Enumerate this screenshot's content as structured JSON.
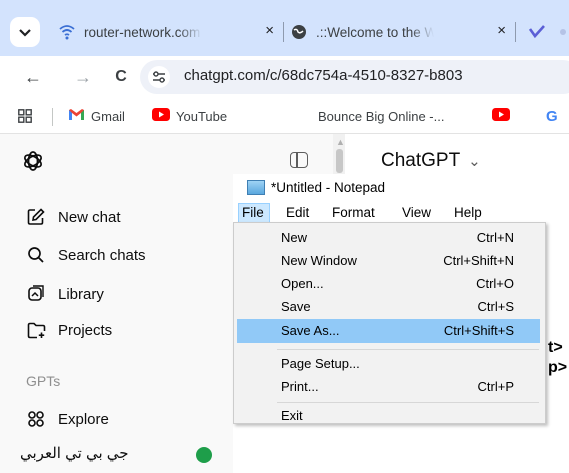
{
  "browser": {
    "tabs": [
      {
        "title": "router-network.com",
        "close": "×"
      },
      {
        "title": ".::Welcome to the Web",
        "close": "×"
      },
      {
        "title": ""
      }
    ],
    "nav": {
      "back": "←",
      "forward": "→",
      "reload": "C"
    },
    "address": "chatgpt.com/c/68dc754a-4510-8327-b803",
    "bookmarks": [
      "Gmail",
      "YouTube",
      "Bounce Big Online -...",
      "G"
    ]
  },
  "chatgpt": {
    "sidebar": {
      "items": [
        {
          "label": "New chat"
        },
        {
          "label": "Search chats"
        },
        {
          "label": "Library"
        },
        {
          "label": "Projects"
        }
      ],
      "gpts_label": "GPTs",
      "explore_label": "Explore",
      "arabic_gpt": "جي بي تي العربي"
    },
    "model_title": "ChatGPT",
    "model_chevron": "⌄",
    "peek_text": [
      "t>",
      "p>"
    ]
  },
  "notepad": {
    "title": "*Untitled - Notepad",
    "menus": [
      "File",
      "Edit",
      "Format",
      "View",
      "Help"
    ],
    "file_menu": {
      "items": [
        {
          "label": "New",
          "shortcut": "Ctrl+N"
        },
        {
          "label": "New Window",
          "shortcut": "Ctrl+Shift+N"
        },
        {
          "label": "Open...",
          "shortcut": "Ctrl+O"
        },
        {
          "label": "Save",
          "shortcut": "Ctrl+S"
        },
        {
          "label": "Save As...",
          "shortcut": "Ctrl+Shift+S",
          "highlighted": true
        },
        {
          "label": "Page Setup...",
          "shortcut": ""
        },
        {
          "label": "Print...",
          "shortcut": "Ctrl+P"
        },
        {
          "label": "Exit",
          "shortcut": ""
        }
      ]
    }
  },
  "colors": {
    "tabstrip": "#d3e3fd",
    "menu_highlight": "#91c9f7",
    "file_menu_active": "#cce8ff"
  }
}
